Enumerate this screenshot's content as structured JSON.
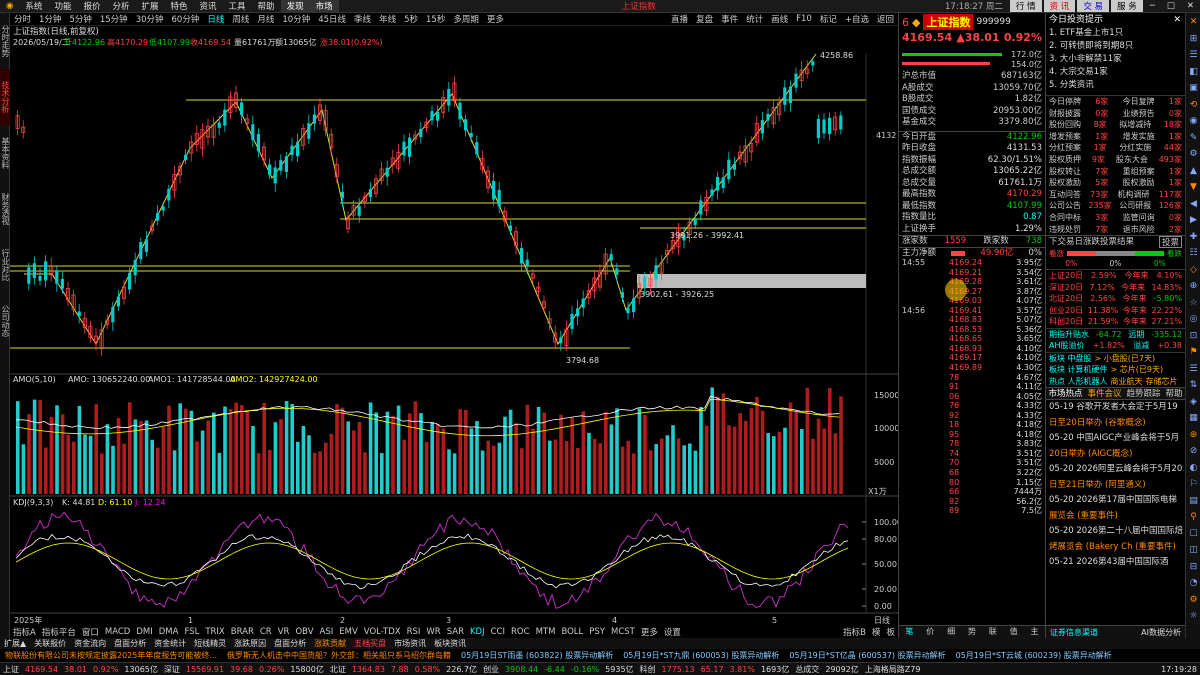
{
  "menu": {
    "items": [
      "系统",
      "功能",
      "报价",
      "分析",
      "扩展",
      "特色",
      "资讯",
      "工具",
      "帮助"
    ],
    "discover": "发现",
    "market": "市场",
    "center_title": "上证指数",
    "clock": "17:18:27 周二",
    "right_buttons": [
      "行 情",
      "资 讯",
      "交 易",
      "服 务"
    ]
  },
  "toolbar": {
    "periods": [
      "分时",
      "1分钟",
      "5分钟",
      "15分钟",
      "30分钟",
      "60分钟",
      "日线",
      "周线",
      "月线",
      "10分钟",
      "45日线",
      "季线",
      "年线",
      "5秒",
      "15秒",
      "多周期",
      "更多"
    ],
    "active": "日线",
    "right": [
      "直播",
      "复盘",
      "事件",
      "统计",
      "画线",
      "F10",
      "标记",
      "+自选",
      "返回"
    ]
  },
  "sidebar": [
    "分时走势",
    "技术分析",
    "基本资料",
    "财务透视",
    "行业对比",
    "公司动态"
  ],
  "chart": {
    "title": "上证指数(日线,前复权)",
    "date": "2026/05/19/二",
    "open": "开4122.96",
    "high": "高4170.29",
    "low": "低4107.99",
    "close": "收4169.54",
    "vol": "量61761万",
    "amount": "额13065亿",
    "change": "涨38.01(0.92%)",
    "price_right": "4132",
    "labels": {
      "peak": "4258.86",
      "r1": "3991.26 - 3992.41",
      "r2": "3902.61 - 3926.25",
      "low": "3794.68"
    },
    "x_labels": [
      "2025年",
      "1",
      "2",
      "3",
      "4",
      "5"
    ],
    "daily_label": "日线"
  },
  "amo": {
    "title": "AMO(5,10)",
    "amo": "AMO: 130652240.00",
    "amo1": "AMO1: 141728544.00",
    "amo2": "AMO2: 142927424.00",
    "ticks": [
      "15000",
      "10000",
      "5000",
      "X1万"
    ]
  },
  "kdj": {
    "title": "KDJ(9,3,3)",
    "k": "K: 44.81",
    "d": "D: 61.10",
    "j": "J: 12.24",
    "ticks": [
      "100.00",
      "80.00",
      "50.00",
      "20.00",
      "0.00"
    ]
  },
  "indicators": [
    "指标A",
    "指标平台",
    "窗口",
    "MACD",
    "DMI",
    "DMA",
    "FSL",
    "TRIX",
    "BRAR",
    "CR",
    "VR",
    "OBV",
    "ASI",
    "EMV",
    "VOL-TDX",
    "RSI",
    "WR",
    "SAR",
    "KDJ",
    "CCI",
    "ROC",
    "MTM",
    "BOLL",
    "PSY",
    "MCST",
    "更多",
    "设置"
  ],
  "indicators_active": "KDJ",
  "indicators_right": [
    "指标B",
    "模",
    "板"
  ],
  "quote": {
    "code_prefix": "6",
    "name": "上证指数",
    "code": "999999",
    "price": "4169.54",
    "chg": "▲38.01",
    "pct": "0.92%",
    "bar_vals": [
      "172.0亿",
      "154.0亿"
    ],
    "rows": [
      [
        "沪总市值",
        "687163亿"
      ],
      [
        "A股成交",
        "13059.70亿"
      ],
      [
        "B股成交",
        "1.82亿"
      ],
      [
        "国债成交",
        "20953.00亿"
      ],
      [
        "基金成交",
        "3379.80亿"
      ]
    ],
    "rows2": [
      [
        "今日开盘",
        "4122.96"
      ],
      [
        "昨日收盘",
        "4131.53"
      ],
      [
        "指数振幅",
        "62.30/1.51%"
      ],
      [
        "总成交额",
        "13065.22亿"
      ],
      [
        "总成交量",
        "61761.1万"
      ],
      [
        "最高指数",
        "4170.29"
      ],
      [
        "最低指数",
        "4107.99"
      ],
      [
        "指数量比",
        "0.87"
      ],
      [
        "上证换手",
        "1.29%"
      ]
    ],
    "updown": {
      "up_label": "涨家数",
      "up": "1559",
      "down_label": "跌家数",
      "down": "738"
    },
    "netin": {
      "label": "主力净额",
      "value": "49.90亿",
      "pct": "0%"
    },
    "ticks": [
      {
        "t": "14:55",
        "p": "4169.24",
        "v": "3.95亿"
      },
      {
        "t": "",
        "p": "4169.21",
        "v": "3.54亿"
      },
      {
        "t": "",
        "p": "4169.28",
        "v": "3.61亿"
      },
      {
        "t": "",
        "p": "4169.27",
        "v": "3.87亿"
      },
      {
        "t": "",
        "p": "4169.03",
        "v": "4.07亿"
      },
      {
        "t": "14:56",
        "p": "4169.41",
        "v": "3.57亿"
      },
      {
        "t": "",
        "p": "4168.83",
        "v": "5.07亿"
      },
      {
        "t": "",
        "p": "4168.53",
        "v": "5.36亿"
      },
      {
        "t": "",
        "p": "4168.65",
        "v": "3.65亿"
      },
      {
        "t": "",
        "p": "4168.93",
        "v": "4.10亿"
      },
      {
        "t": "",
        "p": "4169.17",
        "v": "4.10亿"
      },
      {
        "t": "",
        "p": "4169.89",
        "v": "4.30亿"
      },
      {
        "t": "",
        "p": "",
        "v": "4.67亿"
      },
      {
        "t": "",
        "p": "",
        "v": "4.11亿"
      },
      {
        "t": "",
        "p": "",
        "v": "4.05亿"
      },
      {
        "t": "",
        "p": "",
        "v": "4.33亿"
      },
      {
        "t": "",
        "p": "",
        "v": "4.33亿"
      },
      {
        "t": "",
        "p": "",
        "v": "4.18亿"
      },
      {
        "t": "",
        "p": "",
        "v": "4.18亿"
      },
      {
        "t": "",
        "p": "",
        "v": "3.83亿"
      },
      {
        "t": "",
        "p": "",
        "v": "3.51亿"
      },
      {
        "t": "",
        "p": "",
        "v": "3.51亿"
      },
      {
        "t": "",
        "p": "",
        "v": "3.22亿"
      },
      {
        "t": "",
        "p": "",
        "v": "1.15亿"
      },
      {
        "t": "",
        "p": "",
        "v": "7444万"
      },
      {
        "t": "",
        "p": "",
        "v": "56.2亿"
      },
      {
        "t": "",
        "p": "",
        "v": "7.5亿"
      },
      {
        "t": "",
        "p": "",
        "v": "8.86亿"
      }
    ],
    "tick_prices_extra": [
      "78",
      "91",
      "06",
      "76",
      "92",
      "18",
      "95",
      "78",
      "74",
      "70",
      "68",
      "80",
      "66",
      "82",
      "89",
      "91"
    ],
    "bottom_tabs": [
      "笔",
      "价",
      "细",
      "势",
      "联",
      "值",
      "主"
    ]
  },
  "news": {
    "title": "今日投资提示",
    "items": [
      "1. ETF基金上市1只",
      "2. 可转债即将到期8只",
      "3. 大小非解禁11家",
      "4. 大宗交易1家",
      "5. 分类资讯"
    ],
    "grid": [
      [
        "今日停牌",
        "6家",
        "今日复牌",
        "1家"
      ],
      [
        "财报披露",
        "0家",
        "业绩预告",
        "0家"
      ],
      [
        "股份回购",
        "8家",
        "拟增减持",
        "18家"
      ],
      [
        "增发预案",
        "1家",
        "增发实施",
        "1家"
      ],
      [
        "分红预案",
        "1家",
        "分红实施",
        "44家"
      ],
      [
        "股权质押",
        "9家",
        "股东大会",
        "493家"
      ],
      [
        "股权转让",
        "7家",
        "重组预案",
        "1家"
      ],
      [
        "股权激励",
        "5家",
        "股权激励",
        "1家"
      ],
      [
        "互动问答",
        "73家",
        "机构调研",
        "117家"
      ],
      [
        "公司公告",
        "235家",
        "公司研报",
        "126家"
      ],
      [
        "合同中标",
        "3家",
        "监管问询",
        "0家"
      ],
      [
        "违规处罚",
        "7家",
        "退市风险",
        "2家"
      ]
    ],
    "vote_title": "下交易日涨跌投票结果",
    "vote_btn": "投票",
    "vote_labels": [
      "看涨",
      "看跌"
    ],
    "vote_pcts": [
      "0%",
      "0%",
      "0%"
    ],
    "indices": [
      [
        "上证20日",
        "2.59%",
        "今年来",
        "4.10%"
      ],
      [
        "深证20日",
        "7.12%",
        "今年来",
        "14.83%"
      ],
      [
        "北证20日",
        "2.56%",
        "今年来",
        "-5.80%"
      ],
      [
        "创业20日",
        "11.38%",
        "今年来",
        "22.22%"
      ],
      [
        "科创20日",
        "21.59%",
        "今年来",
        "27.21%"
      ]
    ],
    "funds": [
      [
        "期指升贴水",
        "-64.72",
        "远期",
        "-335.12"
      ],
      [
        "AH股溢价",
        "+1.82%",
        "溢减",
        "+0.38"
      ]
    ],
    "sectors": [
      [
        "板块 中盘股",
        "> 小盘股(已7天)"
      ],
      [
        "板块 计算机硬件",
        "> 芯片(已9天)"
      ],
      [
        "热点 人形机器人",
        "商业航天",
        "存储芯片"
      ]
    ],
    "tabs": [
      "市场热点",
      "事件会议",
      "趋势跟踪",
      "帮助"
    ],
    "list": [
      "05-19 谷歌开发者大会定于5月19",
      "日至20日举办 (谷歌概念)",
      "05-20 中国AIGC产业峰会将于5月",
      "20日举办 (AIGC概念)",
      "05-20 2026阿里云峰会将于5月20",
      "日至21日举办 (阿里通义)",
      "05-20 2026第17届中国国际电梯",
      "展览会 (重要事件)",
      "05-20 2026第二十八届中国国际焙",
      "烤展览会 (Bakery Ch (重要事件)",
      "05-21 2026第43届中国国际酒"
    ],
    "bottom": "证券信息渠道",
    "bottom2": "AI数据分析"
  },
  "ticker": [
    "物联股份有限公司未按规定披露2025年年度报告可能被终...",
    "俄罗斯无人机击中中国货船？外交部：相关船只系马绍尔群岛籍",
    "05月19日ST雨墨 (603822) 股票异动解析",
    "05月19日*ST九鼎 (600053) 股票异动解析",
    "05月19日*ST亿晶 (600537) 股票异动解析",
    "05月19日*ST云城 (600239) 股票异动解析"
  ],
  "statusbar": {
    "items": [
      [
        "上证",
        "4169.54",
        "38.01",
        "0.92%",
        "13065亿"
      ],
      [
        "深证",
        "15569.91",
        "39.68",
        "0.26%",
        "15800亿"
      ],
      [
        "北证",
        "1364.83",
        "7.88",
        "0.58%",
        "226.7亿"
      ],
      [
        "创业",
        "3908.44",
        "-6.44",
        "-0.16%",
        "5935亿"
      ],
      [
        "科创",
        "1775.13",
        "65.17",
        "3.81%",
        "1693亿"
      ]
    ],
    "extra": "总成交",
    "extra2": "29092亿",
    "loc": "上海格局路Z79",
    "time": "17:19:28"
  },
  "bottom_info": [
    "扩展▲",
    "关联报价",
    "资金流向",
    "盘面分析",
    "资金统计",
    "短线精灵",
    "涨跌原因",
    "盘面分析",
    "涨跌贡献",
    "五档买盘",
    "市场资讯",
    "板块资讯"
  ]
}
